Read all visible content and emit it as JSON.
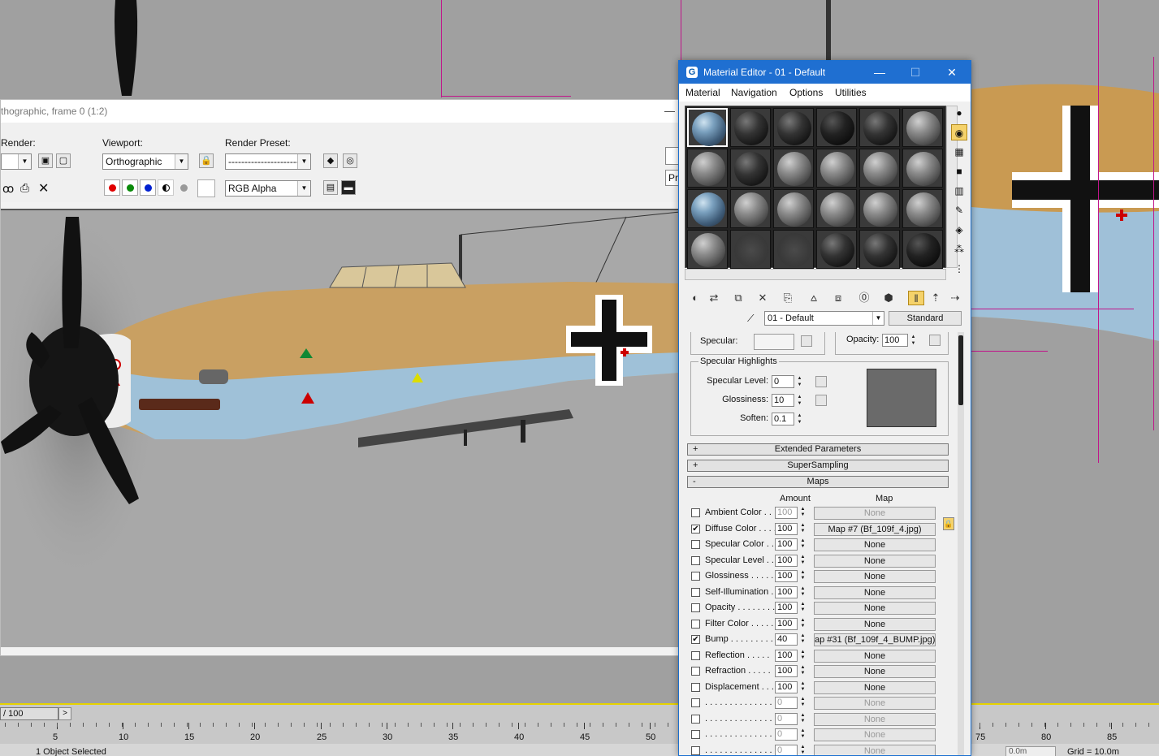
{
  "frame_window": {
    "title": "thographic, frame 0 (1:2)",
    "render_label": "Render:",
    "viewport_label": "Viewport:",
    "viewport_value": "Orthographic",
    "preset_label": "Render Preset:",
    "preset_value": "-------------------------",
    "channel_value": "RGB Alpha",
    "pro_label": "Pro"
  },
  "material_editor": {
    "title": "Material Editor - 01 - Default",
    "menu": [
      "Material",
      "Navigation",
      "Options",
      "Utilities"
    ],
    "material_name": "01 - Default",
    "material_type": "Standard",
    "specular": {
      "specular_label": "Specular:",
      "opacity_label": "Opacity:",
      "opacity_value": "100"
    },
    "specular_highlights": {
      "title": "Specular Highlights",
      "level_label": "Specular Level:",
      "level_value": "0",
      "gloss_label": "Glossiness:",
      "gloss_value": "10",
      "soften_label": "Soften:",
      "soften_value": "0.1"
    },
    "rollouts": [
      "Extended Parameters",
      "SuperSampling",
      "Maps"
    ],
    "maps": {
      "amount_header": "Amount",
      "map_header": "Map",
      "rows": [
        {
          "label": "Ambient Color . . .",
          "amount": "100",
          "map": "None",
          "checked": false,
          "dim": true
        },
        {
          "label": "Diffuse Color . . . .",
          "amount": "100",
          "map": "Map #7 (Bf_109f_4.jpg)",
          "checked": true,
          "dim": false
        },
        {
          "label": "Specular Color . .",
          "amount": "100",
          "map": "None",
          "checked": false,
          "dim": false
        },
        {
          "label": "Specular Level . .",
          "amount": "100",
          "map": "None",
          "checked": false,
          "dim": false
        },
        {
          "label": "Glossiness . . . . .",
          "amount": "100",
          "map": "None",
          "checked": false,
          "dim": false
        },
        {
          "label": "Self-Illumination .",
          "amount": "100",
          "map": "None",
          "checked": false,
          "dim": false
        },
        {
          "label": "Opacity . . . . . . . .",
          "amount": "100",
          "map": "None",
          "checked": false,
          "dim": false
        },
        {
          "label": "Filter Color . . . . .",
          "amount": "100",
          "map": "None",
          "checked": false,
          "dim": false
        },
        {
          "label": "Bump . . . . . . . . .",
          "amount": "40",
          "map": "ap #31 (Bf_109f_4_BUMP.jpg)",
          "checked": true,
          "dim": false
        },
        {
          "label": "Reflection . . . . .",
          "amount": "100",
          "map": "None",
          "checked": false,
          "dim": false
        },
        {
          "label": "Refraction . . . . .",
          "amount": "100",
          "map": "None",
          "checked": false,
          "dim": false
        },
        {
          "label": "Displacement . . .",
          "amount": "100",
          "map": "None",
          "checked": false,
          "dim": false
        },
        {
          "label": ". . . . . . . . . . . . . . .",
          "amount": "0",
          "map": "None",
          "checked": false,
          "dim": true
        },
        {
          "label": ". . . . . . . . . . . . . . .",
          "amount": "0",
          "map": "None",
          "checked": false,
          "dim": true
        },
        {
          "label": ". . . . . . . . . . . . . . .",
          "amount": "0",
          "map": "None",
          "checked": false,
          "dim": true
        },
        {
          "label": ". . . . . . . . . . . . . . .",
          "amount": "0",
          "map": "None",
          "checked": false,
          "dim": true
        }
      ]
    },
    "slots": [
      "camo",
      "dark",
      "dark",
      "black",
      "dark",
      "grey",
      "grey",
      "dark",
      "grey",
      "grey",
      "grey",
      "grey",
      "camo",
      "grey",
      "grey",
      "grey",
      "grey",
      "grey",
      "grey",
      "flat",
      "flat",
      "dark",
      "dark",
      "black"
    ]
  },
  "timeline": {
    "frame_display": "/ 100",
    "ticks": [
      "5",
      "10",
      "15",
      "20",
      "25",
      "30",
      "35",
      "40",
      "45",
      "50",
      "75",
      "80",
      "85"
    ],
    "status": "1 Object Selected",
    "coord": "0.0m",
    "grid": "Grid = 10.0m"
  },
  "colors": {
    "title_blue": "#1f6fd1",
    "timeline_yellow": "#e6d200",
    "gizmo_magenta": "#c0158a"
  }
}
